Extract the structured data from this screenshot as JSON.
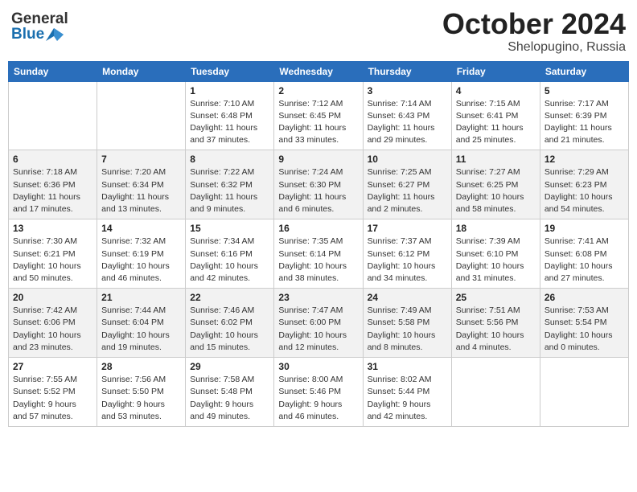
{
  "header": {
    "logo_general": "General",
    "logo_blue": "Blue",
    "month": "October 2024",
    "location": "Shelopugino, Russia"
  },
  "days_of_week": [
    "Sunday",
    "Monday",
    "Tuesday",
    "Wednesday",
    "Thursday",
    "Friday",
    "Saturday"
  ],
  "weeks": [
    [
      {
        "day": "",
        "info": ""
      },
      {
        "day": "",
        "info": ""
      },
      {
        "day": "1",
        "info": "Sunrise: 7:10 AM\nSunset: 6:48 PM\nDaylight: 11 hours and 37 minutes."
      },
      {
        "day": "2",
        "info": "Sunrise: 7:12 AM\nSunset: 6:45 PM\nDaylight: 11 hours and 33 minutes."
      },
      {
        "day": "3",
        "info": "Sunrise: 7:14 AM\nSunset: 6:43 PM\nDaylight: 11 hours and 29 minutes."
      },
      {
        "day": "4",
        "info": "Sunrise: 7:15 AM\nSunset: 6:41 PM\nDaylight: 11 hours and 25 minutes."
      },
      {
        "day": "5",
        "info": "Sunrise: 7:17 AM\nSunset: 6:39 PM\nDaylight: 11 hours and 21 minutes."
      }
    ],
    [
      {
        "day": "6",
        "info": "Sunrise: 7:18 AM\nSunset: 6:36 PM\nDaylight: 11 hours and 17 minutes."
      },
      {
        "day": "7",
        "info": "Sunrise: 7:20 AM\nSunset: 6:34 PM\nDaylight: 11 hours and 13 minutes."
      },
      {
        "day": "8",
        "info": "Sunrise: 7:22 AM\nSunset: 6:32 PM\nDaylight: 11 hours and 9 minutes."
      },
      {
        "day": "9",
        "info": "Sunrise: 7:24 AM\nSunset: 6:30 PM\nDaylight: 11 hours and 6 minutes."
      },
      {
        "day": "10",
        "info": "Sunrise: 7:25 AM\nSunset: 6:27 PM\nDaylight: 11 hours and 2 minutes."
      },
      {
        "day": "11",
        "info": "Sunrise: 7:27 AM\nSunset: 6:25 PM\nDaylight: 10 hours and 58 minutes."
      },
      {
        "day": "12",
        "info": "Sunrise: 7:29 AM\nSunset: 6:23 PM\nDaylight: 10 hours and 54 minutes."
      }
    ],
    [
      {
        "day": "13",
        "info": "Sunrise: 7:30 AM\nSunset: 6:21 PM\nDaylight: 10 hours and 50 minutes."
      },
      {
        "day": "14",
        "info": "Sunrise: 7:32 AM\nSunset: 6:19 PM\nDaylight: 10 hours and 46 minutes."
      },
      {
        "day": "15",
        "info": "Sunrise: 7:34 AM\nSunset: 6:16 PM\nDaylight: 10 hours and 42 minutes."
      },
      {
        "day": "16",
        "info": "Sunrise: 7:35 AM\nSunset: 6:14 PM\nDaylight: 10 hours and 38 minutes."
      },
      {
        "day": "17",
        "info": "Sunrise: 7:37 AM\nSunset: 6:12 PM\nDaylight: 10 hours and 34 minutes."
      },
      {
        "day": "18",
        "info": "Sunrise: 7:39 AM\nSunset: 6:10 PM\nDaylight: 10 hours and 31 minutes."
      },
      {
        "day": "19",
        "info": "Sunrise: 7:41 AM\nSunset: 6:08 PM\nDaylight: 10 hours and 27 minutes."
      }
    ],
    [
      {
        "day": "20",
        "info": "Sunrise: 7:42 AM\nSunset: 6:06 PM\nDaylight: 10 hours and 23 minutes."
      },
      {
        "day": "21",
        "info": "Sunrise: 7:44 AM\nSunset: 6:04 PM\nDaylight: 10 hours and 19 minutes."
      },
      {
        "day": "22",
        "info": "Sunrise: 7:46 AM\nSunset: 6:02 PM\nDaylight: 10 hours and 15 minutes."
      },
      {
        "day": "23",
        "info": "Sunrise: 7:47 AM\nSunset: 6:00 PM\nDaylight: 10 hours and 12 minutes."
      },
      {
        "day": "24",
        "info": "Sunrise: 7:49 AM\nSunset: 5:58 PM\nDaylight: 10 hours and 8 minutes."
      },
      {
        "day": "25",
        "info": "Sunrise: 7:51 AM\nSunset: 5:56 PM\nDaylight: 10 hours and 4 minutes."
      },
      {
        "day": "26",
        "info": "Sunrise: 7:53 AM\nSunset: 5:54 PM\nDaylight: 10 hours and 0 minutes."
      }
    ],
    [
      {
        "day": "27",
        "info": "Sunrise: 7:55 AM\nSunset: 5:52 PM\nDaylight: 9 hours and 57 minutes."
      },
      {
        "day": "28",
        "info": "Sunrise: 7:56 AM\nSunset: 5:50 PM\nDaylight: 9 hours and 53 minutes."
      },
      {
        "day": "29",
        "info": "Sunrise: 7:58 AM\nSunset: 5:48 PM\nDaylight: 9 hours and 49 minutes."
      },
      {
        "day": "30",
        "info": "Sunrise: 8:00 AM\nSunset: 5:46 PM\nDaylight: 9 hours and 46 minutes."
      },
      {
        "day": "31",
        "info": "Sunrise: 8:02 AM\nSunset: 5:44 PM\nDaylight: 9 hours and 42 minutes."
      },
      {
        "day": "",
        "info": ""
      },
      {
        "day": "",
        "info": ""
      }
    ]
  ]
}
